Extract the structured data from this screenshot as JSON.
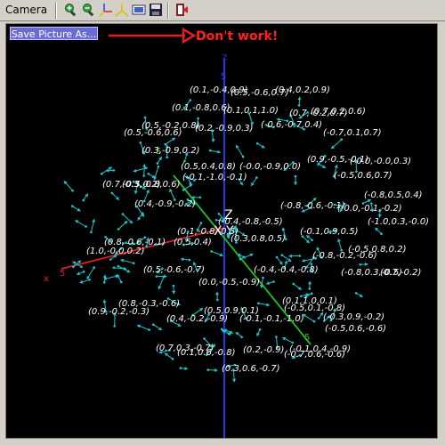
{
  "menu": {
    "camera": "Camera"
  },
  "toolbar": {
    "icons": [
      "zoom-in-icon",
      "zoom-out-icon",
      "axes-icon",
      "axes-alt-icon",
      "picture-icon",
      "save-disk-icon",
      "exit-icon"
    ]
  },
  "save_button": "Save Picture As...",
  "annotation": "Don't work!",
  "axes": {
    "x": "x",
    "z": "z",
    "x_tick": "5",
    "z_tick": "5",
    "y_tick": "5",
    "origin_x": "X",
    "origin_y": "Y",
    "origin_z": "Z"
  },
  "colors": {
    "background": "#000000",
    "vector": "#1cc8d0",
    "label": "#ffffff",
    "x_axis": "#e02020",
    "y_axis": "#20c020",
    "z_axis": "#2040ff",
    "annotation": "#ff2020"
  },
  "labels": [
    "(0.1,-0.4,0.9)",
    "(0.5,-0.6,0.7)",
    "(0.4,0.2,0.9)",
    "(0.1,-0.8,0.6)",
    "(0.1,0.1,1.0)",
    "(0.7,-0.2,0.7)",
    "(0.7,0.2,0.6)",
    "(0.5,-0.2,0.8)",
    "(0.2,-0.9,0.3)",
    "(-0.6,-0.7,0.4)",
    "(0.5,-0.6,0.6)",
    "(-0.7,0.1,0.7)",
    "(0.3,-0.9,0.2)",
    "(0.9,-0.5,-0.1)",
    "(-0.0,-0.0,0.3)",
    "(0.5,0.4,0.8)",
    "(-0.0,-0.9,0.0)",
    "(-0.1,-1.0,-0.1)",
    "(-0.5,0.6,0.7)",
    "(0.7,-0.5,0.2)",
    "(0.3,-0.8,0.6)",
    "(-0.8,0.5,0.4)",
    "(0.4,-0.9,-0.2)",
    "(-0.8,-0.6,-0.1)",
    "(-0.0,-0.1,-0.2)",
    "(-0.4,-0.8,-0.5)",
    "(-1.0,0.3,-0.0)",
    "(0.1,-0.8,-0.5)",
    "(0.3,0.8,0.5)",
    "(-0.1,0.9,0.5)",
    "(0.8,-0.6,-0.1)",
    "(0.5,0.4)",
    "(1.0,-0.0,0.2)",
    "(-0.5,0.8,0.2)",
    "(-0.8,-0.2,-0.6)",
    "(0.5,-0.6,-0.7)",
    "(-0.4,-0.4,-0.8)",
    "(-0.8,0.3,-0.5)",
    "(0.7,-0.2)",
    "(0.0,-0.5,-0.9)",
    "(0.1,1.0,0.1)",
    "(0.8,-0.3,-0.6)",
    "(-0.5,0.1,-0.8)",
    "(0.9,-0.2,-0.3)",
    "(0.5,0.9,0.1)",
    "(-0.3,0.9,-0.2)",
    "(0.4,-0.2,-0.9)",
    "(-0.1,-0.1,-1.0)",
    "(-0.5,0.6,-0.6)",
    "(0.7,0.3,-0.7)",
    "(0.2,-0.9)",
    "(-0.1,0.4,-0.9)",
    "(0.1,0.6,-0.8)",
    "(-0.7,0.6,-0.6)",
    "(0.3,0.6,-0.7)"
  ]
}
